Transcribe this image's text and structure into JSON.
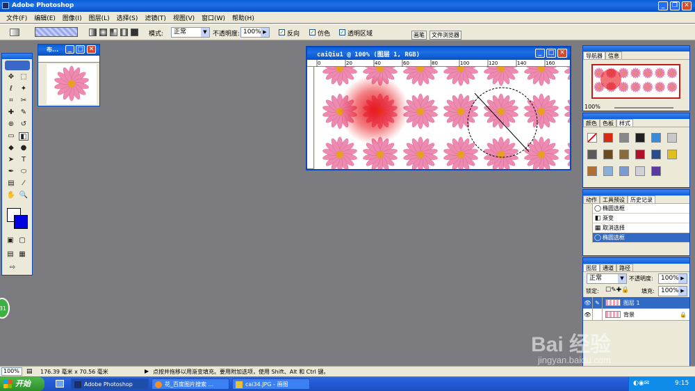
{
  "app": {
    "title": "Adobe Photoshop"
  },
  "menu": [
    "文件(F)",
    "编辑(E)",
    "图像(I)",
    "图层(L)",
    "选择(S)",
    "滤镜(T)",
    "视图(V)",
    "窗口(W)",
    "帮助(H)"
  ],
  "options": {
    "mode_label": "模式:",
    "mode_value": "正常",
    "opacity_label": "不透明度:",
    "opacity_value": "100%",
    "reverse_label": "反向",
    "dither_label": "仿色",
    "transparency_label": "透明区域",
    "tabs": [
      "画笔",
      "文件浏览器"
    ]
  },
  "small_doc": {
    "title": "布..."
  },
  "main_doc": {
    "title": "caiQiu1 @ 100% (图层 1, RGB)",
    "ruler_ticks": [
      "0",
      "20",
      "40",
      "60",
      "80",
      "100",
      "120",
      "140",
      "160"
    ]
  },
  "navigator": {
    "tabs": [
      "导航器",
      "信息"
    ],
    "zoom": "100%"
  },
  "color_panel": {
    "tabs": [
      "颜色",
      "色板",
      "样式"
    ]
  },
  "history": {
    "tabs": [
      "动作",
      "工具预设",
      "历史记录"
    ],
    "items": [
      {
        "label": "椭圆选框",
        "icon": "ellipse-icon",
        "active": false
      },
      {
        "label": "渐变",
        "icon": "gradient-icon",
        "active": false
      },
      {
        "label": "取消选择",
        "icon": "deselect-icon",
        "active": false
      },
      {
        "label": "椭圆选框",
        "icon": "ellipse-icon",
        "active": true
      }
    ]
  },
  "layers": {
    "tabs": [
      "图层",
      "通道",
      "路径"
    ],
    "blend_mode": "正常",
    "opacity_label": "不透明度:",
    "opacity_value": "100%",
    "lock_label": "锁定:",
    "fill_label": "填充:",
    "fill_value": "100%",
    "items": [
      {
        "name": "图层 1",
        "active": true
      },
      {
        "name": "背景",
        "active": false
      }
    ]
  },
  "status": {
    "zoom": "100%",
    "doc_size": "176.39 毫米 x 70.56 毫米",
    "hint": "点按并拖移以用渐变填充。要用附加选项，使用 Shift、Alt 和 Ctrl 键。"
  },
  "badge": {
    "text": "31"
  },
  "watermark": {
    "text": "Bai 经验",
    "sub": "jingyan.baidu.com"
  },
  "taskbar": {
    "start": "开始",
    "buttons": [
      "Adobe Photoshop",
      "花_百度图片搜索 ...",
      "cai34.JPG - 画图"
    ],
    "clock": "9:15"
  },
  "colors": {
    "accent": "#0a5fd8",
    "flower": "#ee8ab0",
    "flower_center": "#e8a020",
    "red_glow": "#e8141a"
  }
}
